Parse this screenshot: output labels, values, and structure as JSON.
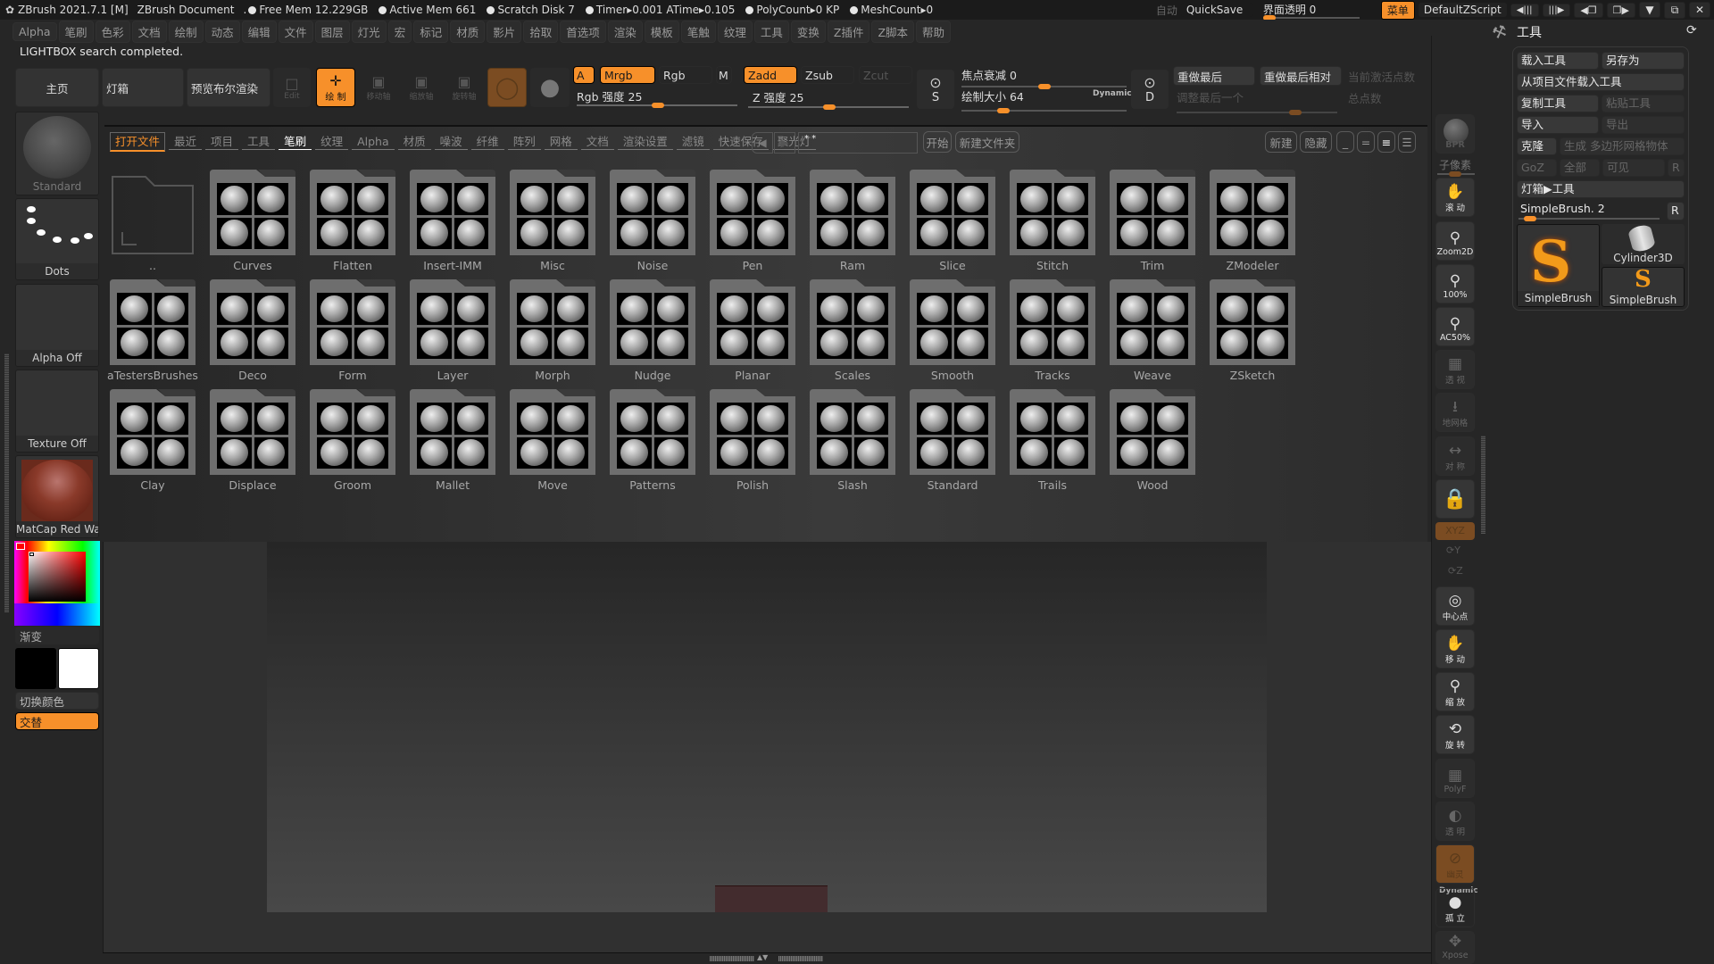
{
  "titlebar": {
    "app": "ZBrush 2021.7.1 [M]",
    "document": "ZBrush Document",
    "free_mem": "Free Mem 12.229GB",
    "active_mem": "Active Mem 661",
    "scratch_disk": "Scratch Disk 7",
    "timer": "Timer▸0.001 ATime▸0.105",
    "polycount": "PolyCount▸0 KP",
    "meshcount": "MeshCount▸0",
    "auto_label": "自动",
    "quicksave": "QuickSave",
    "ui_transparency": "界面透明 0",
    "ui_transparency_value": 0,
    "menu_btn": "菜单",
    "script": "DefaultZScript"
  },
  "menubar": [
    "Alpha",
    "笔刷",
    "色彩",
    "文档",
    "绘制",
    "动态",
    "编辑",
    "文件",
    "图层",
    "灯光",
    "宏",
    "标记",
    "材质",
    "影片",
    "拾取",
    "首选项",
    "渲染",
    "模板",
    "笔触",
    "纹理",
    "工具",
    "变换",
    "Z插件",
    "Z脚本",
    "帮助"
  ],
  "status": "LIGHTBOX search completed.",
  "shelf": {
    "home": "主页",
    "lightbox": "灯箱",
    "bpr_preview": "预览布尔渲染",
    "edit": "Edit",
    "draw": "绘 制",
    "move": "移动轴",
    "scale": "缩放轴",
    "rotate": "旋转轴",
    "a": "A",
    "mrgb": "Mrgb",
    "rgb": "Rgb",
    "m": "M",
    "rgb_intensity": "Rgb 强度 25",
    "rgb_intensity_value": 25,
    "zadd": "Zadd",
    "zsub": "Zsub",
    "zcut": "Zcut",
    "z_intensity": "Z 强度 25",
    "z_intensity_value": 25,
    "focal_shift": "焦点衰减 0",
    "focal_shift_value": 0,
    "draw_size": "绘制大小 64",
    "draw_size_value": 64,
    "dynamic": "Dynamic",
    "redo_last": "重做最后",
    "redo_last_relative": "重做最后相对",
    "adjust_last": "调整最后一个",
    "active_points": "当前激活点数",
    "total_points": "总点数"
  },
  "left": {
    "brush": "Standard",
    "stroke": "Dots",
    "alpha": "Alpha Off",
    "texture": "Texture Off",
    "material": "MatCap Red Wax",
    "gradient": "渐变",
    "switch_color": "切换颜色",
    "alternate": "交替"
  },
  "lightbox": {
    "tabs": [
      "打开文件",
      "最近",
      "项目",
      "工具",
      "笔刷",
      "纹理",
      "Alpha",
      "材质",
      "噪波",
      "纤维",
      "阵列",
      "网格",
      "文档",
      "渲染设置",
      "滤镜",
      "快速保存",
      "聚光灯"
    ],
    "search_value": "* *",
    "start": "开始",
    "new_folder": "新建文件夹",
    "new": "新建",
    "hide": "隐藏",
    "folders": [
      "..",
      "Curves",
      "Flatten",
      "Insert-IMM",
      "Misc",
      "Noise",
      "Pen",
      "Ram",
      "Slice",
      "Stitch",
      "Trim",
      "ZModeler",
      "aTestersBrushes",
      "Deco",
      "Form",
      "Layer",
      "Morph",
      "Nudge",
      "Planar",
      "Scales",
      "Smooth",
      "Tracks",
      "Weave",
      "ZSketch",
      "Clay",
      "Displace",
      "Groom",
      "Mallet",
      "Move",
      "Patterns",
      "Polish",
      "Slash",
      "Standard",
      "Trails",
      "Wood"
    ]
  },
  "right_strip": {
    "bpr": "BPR",
    "subpixel": "子像素",
    "scroll": "滚 动",
    "zoom2d": "Zoom2D",
    "actual": "100%",
    "ac50": "AC50%",
    "persp": "透 视",
    "floor": "地网格",
    "sym": "对 称",
    "xyz": "XYZ",
    "y": "Y",
    "z": "Z",
    "center": "中心点",
    "move": "移 动",
    "scale": "缩 放",
    "rotate": "旋 转",
    "polyf": "PolyF",
    "transp": "透 明",
    "ghost": "幽灵",
    "dynamic": "Dynamic",
    "solo": "孤 立",
    "xpose": "Xpose"
  },
  "tool_panel": {
    "title": "工具",
    "load_tool": "载入工具",
    "save_as": "另存为",
    "load_from_project": "从项目文件载入工具",
    "copy_tool": "复制工具",
    "paste_tool": "粘贴工具",
    "import": "导入",
    "export": "导出",
    "clone": "克隆",
    "make_polymesh": "生成 多边形网格物体",
    "goz": "GoZ",
    "all": "全部",
    "visible": "可见",
    "r": "R",
    "lightbox_tools": "灯箱▶工具",
    "current_tool": "SimpleBrush. 2",
    "current_tool_index": 2,
    "tools": [
      "SimpleBrush",
      "Cylinder3D",
      "SimpleBrush"
    ]
  },
  "colors": {
    "accent": "#f7902a",
    "panel": "#262626",
    "button": "#333333"
  }
}
